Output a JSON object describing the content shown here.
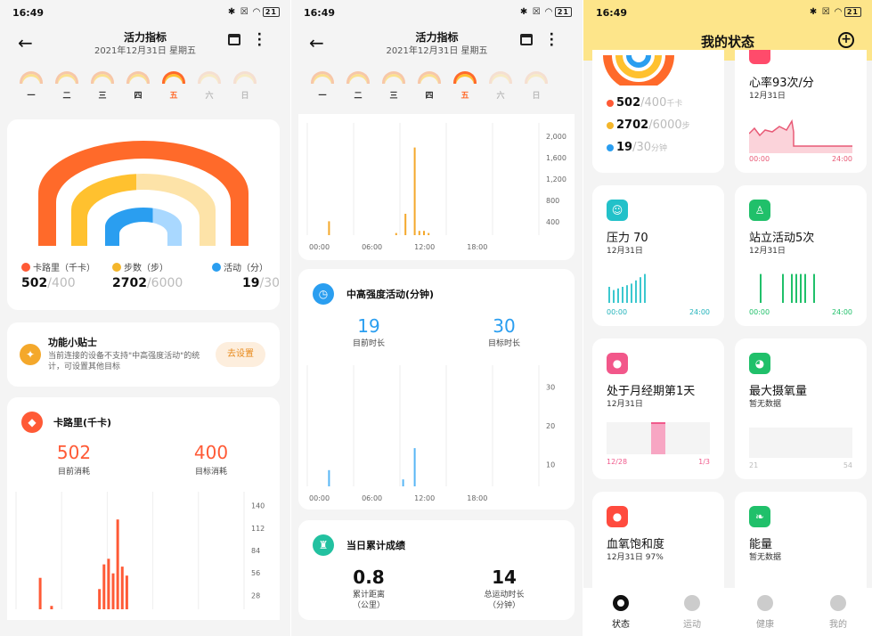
{
  "status_bar": {
    "time": "16:49",
    "icons": "✱ ☒ ◠",
    "battery": "21"
  },
  "activity": {
    "title": "活力指标",
    "subtitle": "2021年12月31日  星期五",
    "days": [
      "一",
      "二",
      "三",
      "四",
      "五",
      "六",
      "日"
    ],
    "today_index": 4,
    "summary": [
      {
        "label": "卡路里（千卡）",
        "value": "502",
        "goal": "/400",
        "color": "#ff5a36"
      },
      {
        "label": "步数（步）",
        "value": "2702",
        "goal": "/6000",
        "color": "#f4b62b"
      },
      {
        "label": "活动（分）",
        "value": "19",
        "goal": "/30",
        "color": "#2a9ef0"
      }
    ],
    "tip": {
      "title": "功能小贴士",
      "text": "当前连接的设备不支持\"中高强度活动\"的统计，可设置其他目标",
      "button": "去设置"
    },
    "calories": {
      "title": "卡路里(千卡)",
      "current": "502",
      "current_label": "目前消耗",
      "goal": "400",
      "goal_label": "目标消耗",
      "y_ticks": [
        "140",
        "112",
        "84",
        "56",
        "28"
      ]
    },
    "steps_chart": {
      "y_ticks": [
        "2,000",
        "1,600",
        "1,200",
        "800",
        "400"
      ],
      "x_ticks": [
        "00:00",
        "06:00",
        "12:00",
        "18:00"
      ]
    },
    "intensity": {
      "title": "中高强度活动(分钟)",
      "current": "19",
      "current_label": "目前时长",
      "goal": "30",
      "goal_label": "目标时长",
      "y_ticks": [
        "30",
        "20",
        "10"
      ],
      "x_ticks": [
        "00:00",
        "06:00",
        "12:00",
        "18:00"
      ]
    },
    "daily": {
      "title": "当日累计成绩",
      "distance": "0.8",
      "distance_label": "累计距离",
      "distance_unit": "（公里）",
      "duration": "14",
      "duration_label": "总运动时长",
      "duration_unit": "（分钟）"
    }
  },
  "status_page": {
    "title": "我的状态",
    "summary": [
      {
        "value": "502",
        "goal": "/400",
        "unit": "千卡"
      },
      {
        "value": "2702",
        "goal": "/6000",
        "unit": "步"
      },
      {
        "value": "19",
        "goal": "/30",
        "unit": "分钟"
      }
    ],
    "cards": [
      {
        "title": "心率93次/分",
        "date": "12月31日",
        "x0": "00:00",
        "x1": "24:00"
      },
      {
        "title": "压力 70",
        "date": "12月31日",
        "x0": "00:00",
        "x1": "24:00"
      },
      {
        "title": "站立活动5次",
        "date": "12月31日",
        "x0": "00:00",
        "x1": "24:00"
      },
      {
        "title": "处于月经期第1天",
        "date": "12月31日",
        "x0": "12/28",
        "x1": "1/3"
      },
      {
        "title": "最大摄氧量",
        "date": "暂无数据",
        "x0": "21",
        "x1": "54"
      },
      {
        "title": "血氧饱和度",
        "date": "12月31日  97%"
      },
      {
        "title": "能量",
        "date": "暂无数据"
      }
    ],
    "tabs": [
      "状态",
      "运动",
      "健康",
      "我的"
    ]
  },
  "colors": {
    "orange": "#ff6a2a",
    "yellow": "#ffc12f",
    "blue": "#2a9ef0",
    "teal": "#22c1c9",
    "green": "#20c06a",
    "pink": "#f26b8a",
    "red": "#ff4b3e"
  }
}
